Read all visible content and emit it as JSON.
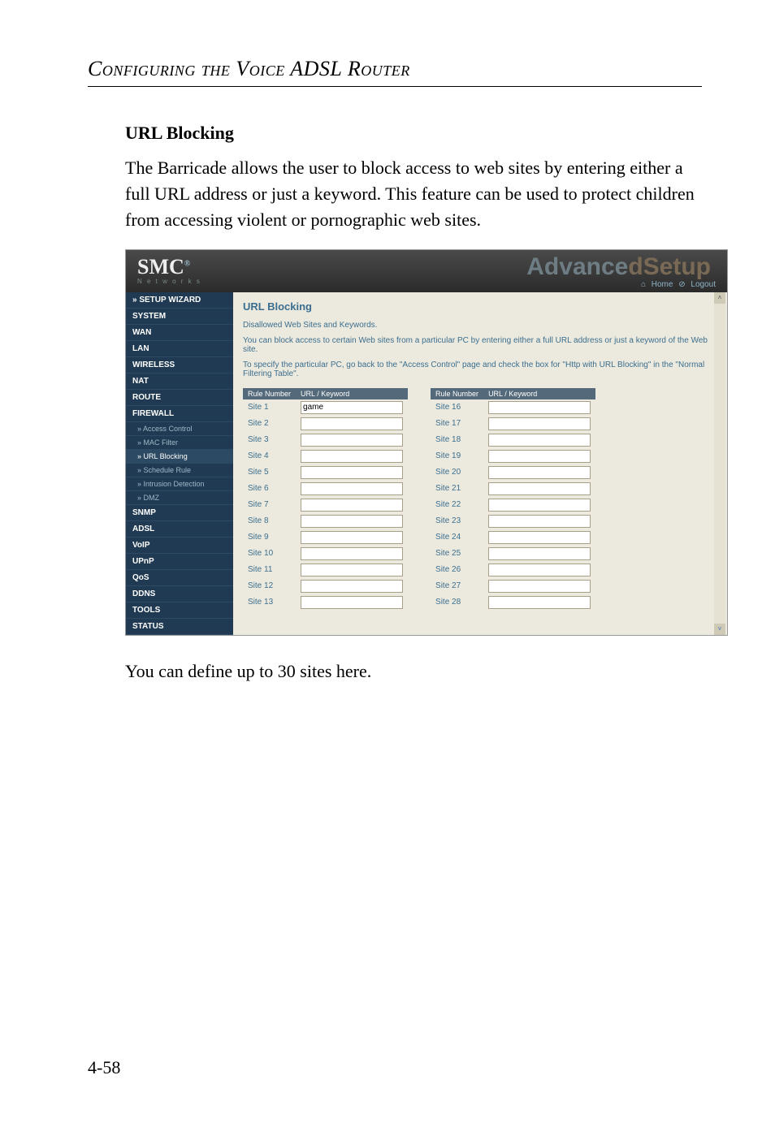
{
  "header": {
    "title": "Configuring the Voice ADSL Router"
  },
  "section": {
    "heading": "URL Blocking",
    "para1": "The Barricade allows the user to block access to web sites by entering either a full URL address or just a keyword. This feature can be used to protect children from accessing violent or pornographic web sites.",
    "para2": "You can define up to 30 sites here."
  },
  "shot": {
    "logo": "SMC",
    "logo_sub": "N e t w o r k s",
    "adv_a": "Advance",
    "adv_b": "d",
    "adv_c": "Setup",
    "link_home": "Home",
    "link_logout": "Logout",
    "side": [
      {
        "label": "» SETUP WIZARD",
        "type": "item"
      },
      {
        "label": "SYSTEM",
        "type": "item"
      },
      {
        "label": "WAN",
        "type": "item"
      },
      {
        "label": "LAN",
        "type": "item"
      },
      {
        "label": "WIRELESS",
        "type": "item"
      },
      {
        "label": "NAT",
        "type": "item"
      },
      {
        "label": "ROUTE",
        "type": "item"
      },
      {
        "label": "FIREWALL",
        "type": "item"
      },
      {
        "label": "» Access Control",
        "type": "sub"
      },
      {
        "label": "» MAC Filter",
        "type": "sub"
      },
      {
        "label": "» URL Blocking",
        "type": "sub",
        "sel": true
      },
      {
        "label": "» Schedule Rule",
        "type": "sub"
      },
      {
        "label": "» Intrusion Detection",
        "type": "sub"
      },
      {
        "label": "» DMZ",
        "type": "sub"
      },
      {
        "label": "SNMP",
        "type": "item"
      },
      {
        "label": "ADSL",
        "type": "item"
      },
      {
        "label": "VoIP",
        "type": "item"
      },
      {
        "label": "UPnP",
        "type": "item"
      },
      {
        "label": "QoS",
        "type": "item"
      },
      {
        "label": "DDNS",
        "type": "item"
      },
      {
        "label": "TOOLS",
        "type": "item"
      },
      {
        "label": "STATUS",
        "type": "item"
      }
    ],
    "content": {
      "title": "URL Blocking",
      "sub": "Disallowed Web Sites and Keywords.",
      "text1": "You can block access to certain Web sites from a particular PC by entering either a full URL address or just a keyword of the Web site.",
      "text2": "To specify the particular PC, go back to the \"Access Control\" page and check the box for \"Http with URL Blocking\" in the \"Normal Filtering Table\".",
      "th_rule": "Rule Number",
      "th_url": "URL / Keyword",
      "left": [
        {
          "n": "Site  1",
          "v": "game"
        },
        {
          "n": "Site  2",
          "v": ""
        },
        {
          "n": "Site  3",
          "v": ""
        },
        {
          "n": "Site  4",
          "v": ""
        },
        {
          "n": "Site  5",
          "v": ""
        },
        {
          "n": "Site  6",
          "v": ""
        },
        {
          "n": "Site  7",
          "v": ""
        },
        {
          "n": "Site  8",
          "v": ""
        },
        {
          "n": "Site  9",
          "v": ""
        },
        {
          "n": "Site  10",
          "v": ""
        },
        {
          "n": "Site  11",
          "v": ""
        },
        {
          "n": "Site  12",
          "v": ""
        },
        {
          "n": "Site  13",
          "v": ""
        }
      ],
      "right": [
        {
          "n": "Site  16",
          "v": ""
        },
        {
          "n": "Site  17",
          "v": ""
        },
        {
          "n": "Site  18",
          "v": ""
        },
        {
          "n": "Site  19",
          "v": ""
        },
        {
          "n": "Site  20",
          "v": ""
        },
        {
          "n": "Site  21",
          "v": ""
        },
        {
          "n": "Site  22",
          "v": ""
        },
        {
          "n": "Site  23",
          "v": ""
        },
        {
          "n": "Site  24",
          "v": ""
        },
        {
          "n": "Site  25",
          "v": ""
        },
        {
          "n": "Site  26",
          "v": ""
        },
        {
          "n": "Site  27",
          "v": ""
        },
        {
          "n": "Site  28",
          "v": ""
        }
      ]
    }
  },
  "page_number": "4-58"
}
